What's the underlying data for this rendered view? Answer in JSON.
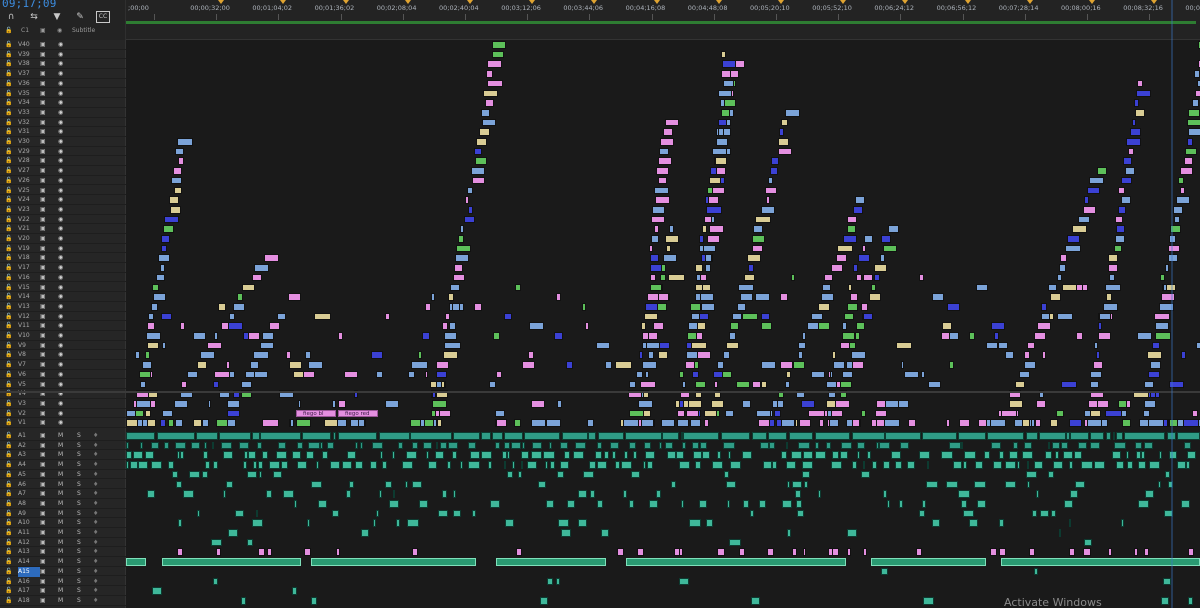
{
  "timecode": "09;17;09",
  "header": {
    "subtitle_label": "Subtitle",
    "cc_label": "CC"
  },
  "ruler_ticks": [
    ";00;00",
    "00;00;32;00",
    "00;01;04;02",
    "00;01;36;02",
    "00;02;08;04",
    "00;02;40;04",
    "00;03;12;06",
    "00;03;44;06",
    "00;04;16;08",
    "00;04;48;08",
    "00;05;20;10",
    "00;05;52;10",
    "00;06;24;12",
    "00;06;56;12",
    "00;07;28;14",
    "00;08;00;16",
    "00;08;32;16",
    "00;09;04"
  ],
  "video_tracks": [
    "V40",
    "V39",
    "V38",
    "V37",
    "V36",
    "V35",
    "V34",
    "V33",
    "V32",
    "V31",
    "V30",
    "V29",
    "V28",
    "V27",
    "V26",
    "V25",
    "V24",
    "V23",
    "V22",
    "V21",
    "V20",
    "V19",
    "V18",
    "V17",
    "V16",
    "V15",
    "V14",
    "V13",
    "V12",
    "V11",
    "V10",
    "V9",
    "V8",
    "V7",
    "V6",
    "V5",
    "V4",
    "V3",
    "V2",
    "V1"
  ],
  "audio_tracks": [
    "A1",
    "A2",
    "A3",
    "A4",
    "A5",
    "A6",
    "A7",
    "A8",
    "A9",
    "A10",
    "A11",
    "A12",
    "A13",
    "A14",
    "A15",
    "A16",
    "A17",
    "A18"
  ],
  "active_audio_track": "A15",
  "audio_mute_label": "M",
  "audio_solo_label": "S",
  "clip_labels": [
    "fiego bl",
    "fiego red"
  ],
  "colors": {
    "pink": "#e48fe0",
    "blue": "#7ba3d8",
    "deep_blue": "#3b41d4",
    "green": "#5dc05a",
    "khaki": "#d9cc94",
    "teal": "#3fb89a",
    "timecode": "#3d8de0"
  },
  "watermark": "Activate Windows"
}
